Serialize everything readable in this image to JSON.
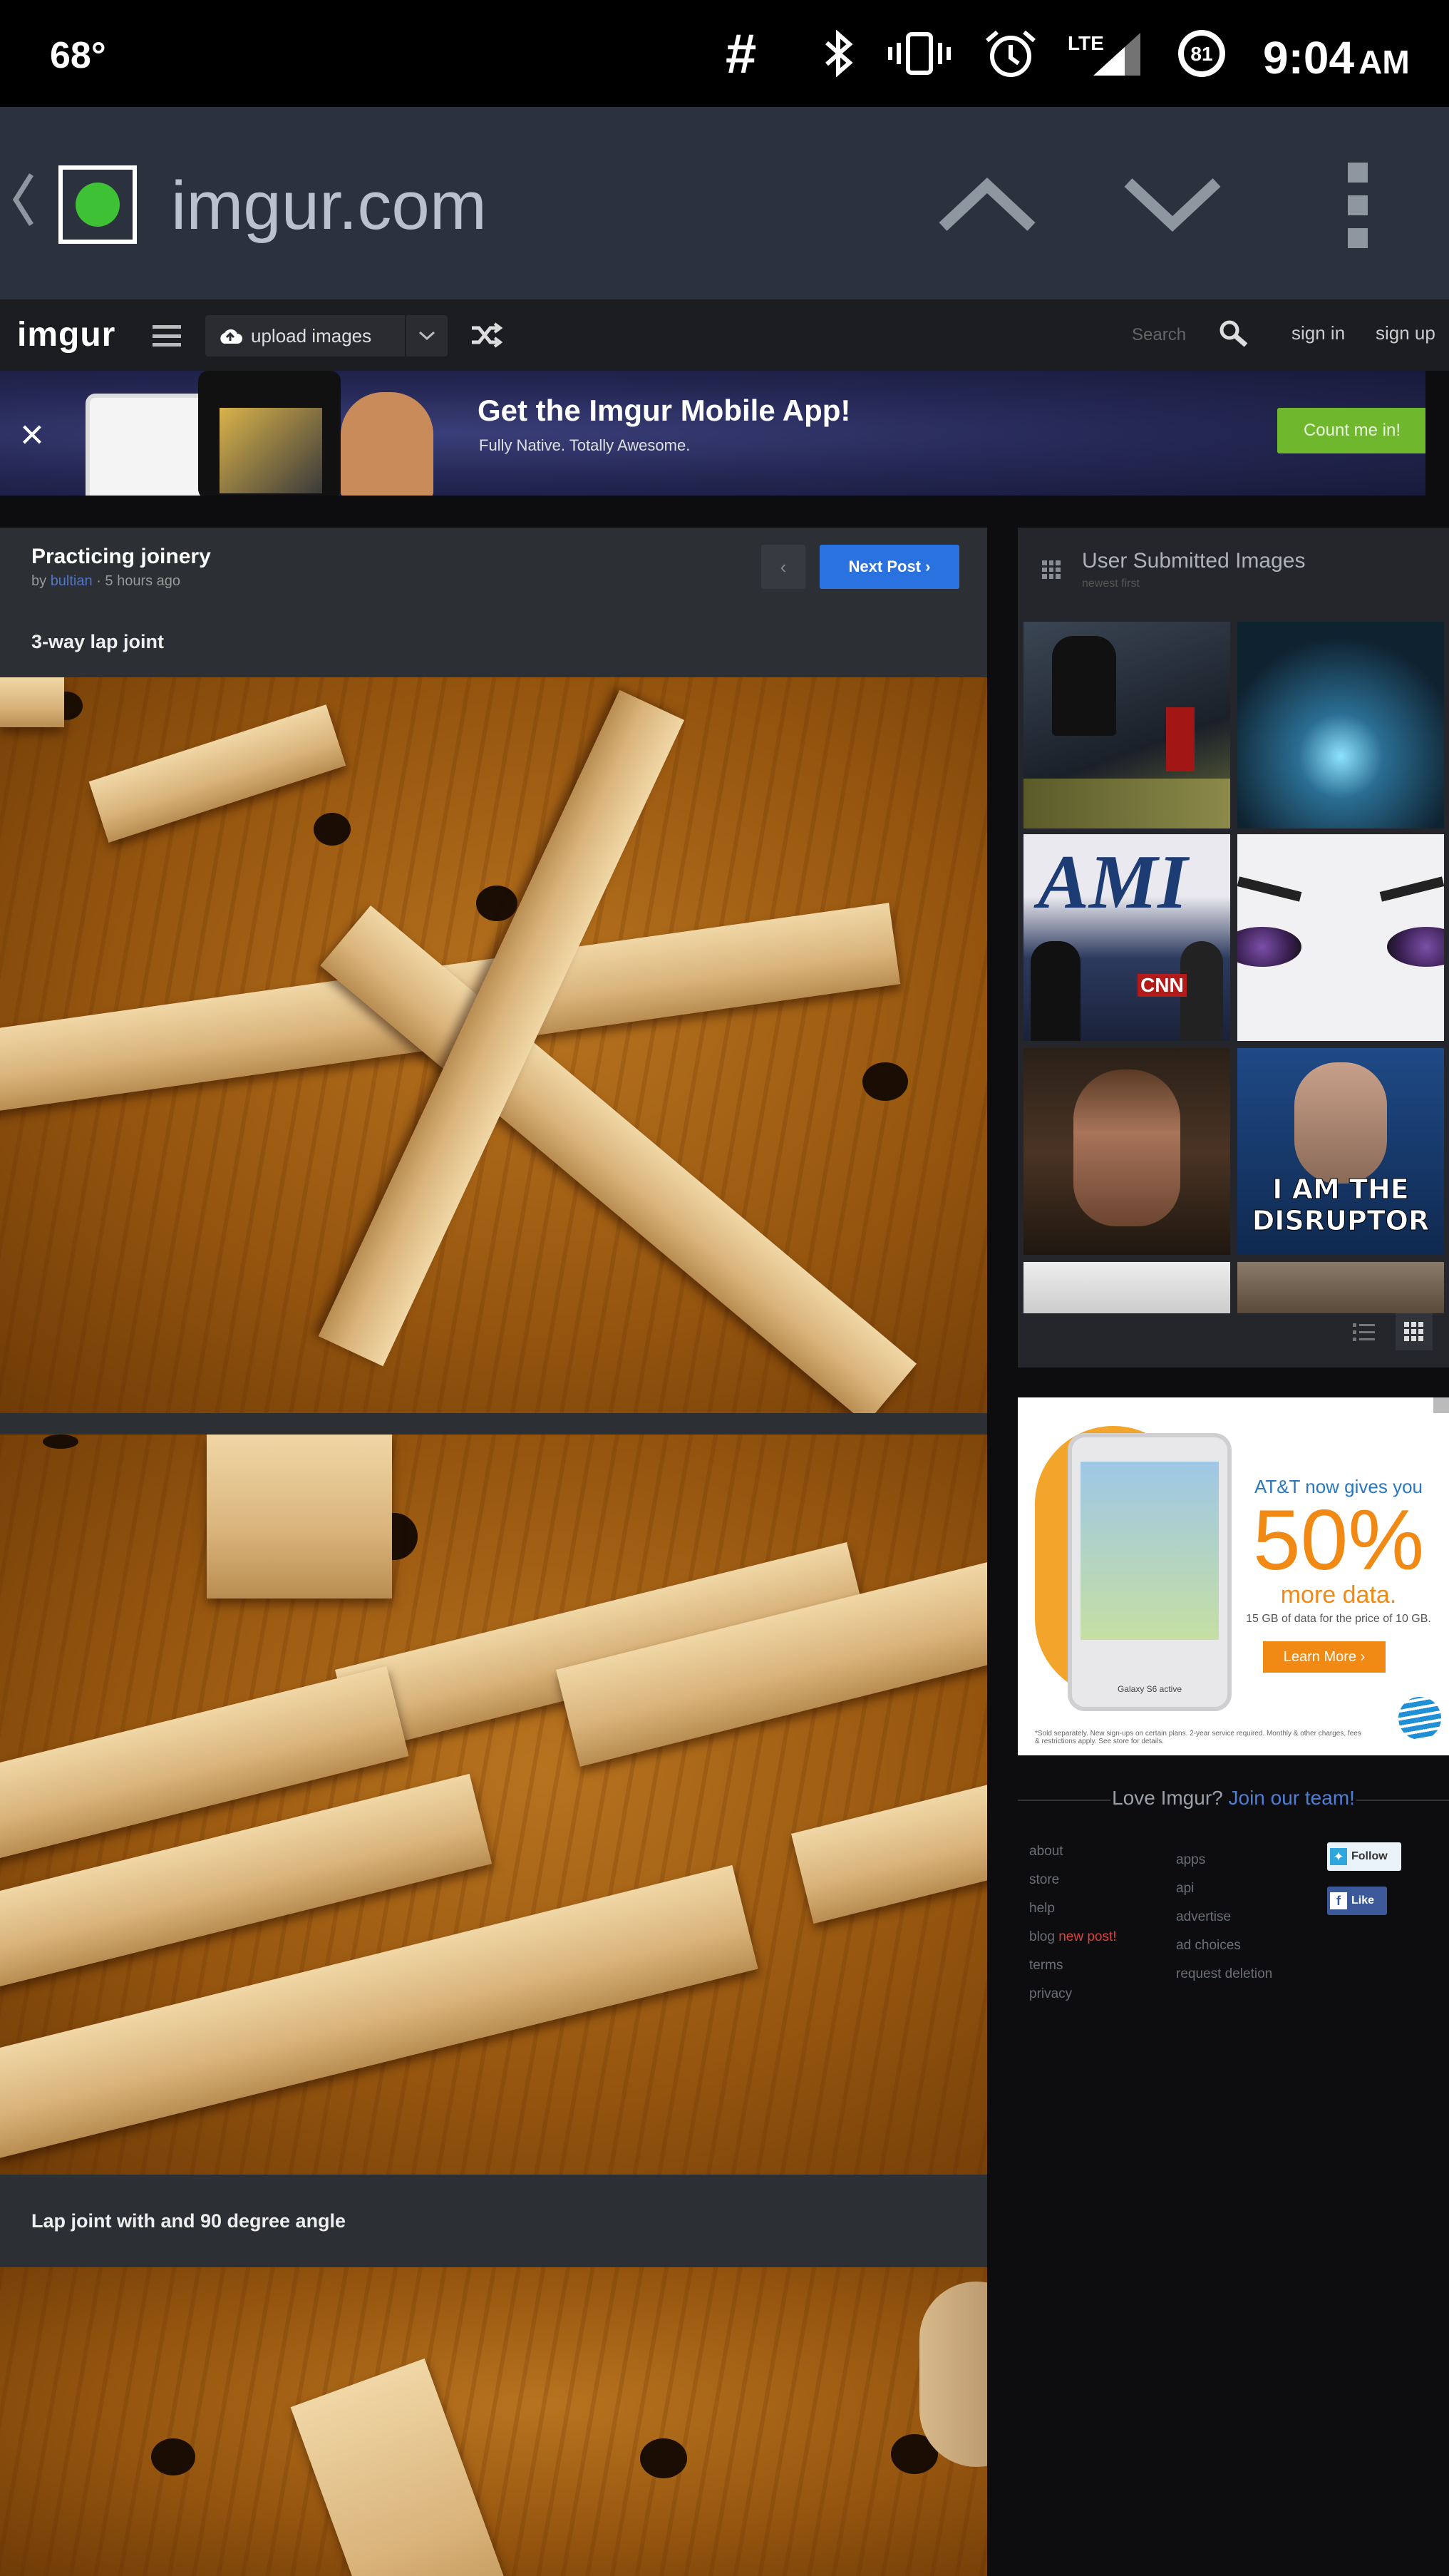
{
  "status_bar": {
    "temperature": "68°",
    "hash_glyph": "#",
    "network": "LTE",
    "battery": "81",
    "time": "9:04",
    "ampm": "AM",
    "icons": [
      "bluetooth-icon",
      "vibrate-icon",
      "alarm-icon",
      "signal-icon",
      "battery-icon"
    ]
  },
  "browser": {
    "url": "imgur.com",
    "favicon_color": "#3fc136",
    "bar_color": "#2b323d"
  },
  "imgur_header": {
    "logo": "imgur",
    "upload_label": "upload images",
    "search_placeholder": "Search",
    "sign_in": "sign in",
    "sign_up": "sign up"
  },
  "banner": {
    "title": "Get the Imgur Mobile App!",
    "subtitle": "Fully Native. Totally Awesome.",
    "cta": "Count me in!",
    "close": "×"
  },
  "post": {
    "title": "Practicing joinery",
    "by_prefix": "by",
    "author": "bultian",
    "age": "· 5 hours ago",
    "next_label": "Next Post ›",
    "prev_label": "‹",
    "captions": [
      "3-way lap joint",
      "Lap joint with and 90 degree angle"
    ]
  },
  "sidebar": {
    "title": "User Submitted Images",
    "subtitle": "newest first",
    "thumb_texts": {
      "ami": "AMI",
      "cnn": "CNN",
      "disruptor_1": "I AM THE",
      "disruptor_2": "DISRUPTOR"
    }
  },
  "ad": {
    "line1": "AT&T now gives you",
    "percent": "50%",
    "more": "more data.",
    "fine": "15 GB of data for the price of 10 GB.",
    "learn": "Learn More ›",
    "phone_caption": "Galaxy S6 active",
    "legal": "*Sold separately. New sign-ups on certain plans. 2-year service required. Monthly & other charges, fees & restrictions apply. See store for details."
  },
  "footer": {
    "prompt": "Love Imgur?",
    "join": "Join our team!",
    "col1": [
      "about",
      "store",
      "help",
      "blog",
      "terms",
      "privacy"
    ],
    "blog_badge": "new post!",
    "col2": [
      "apps",
      "api",
      "advertise",
      "ad choices",
      "request deletion"
    ],
    "twitter": "Follow",
    "facebook": "Like"
  }
}
